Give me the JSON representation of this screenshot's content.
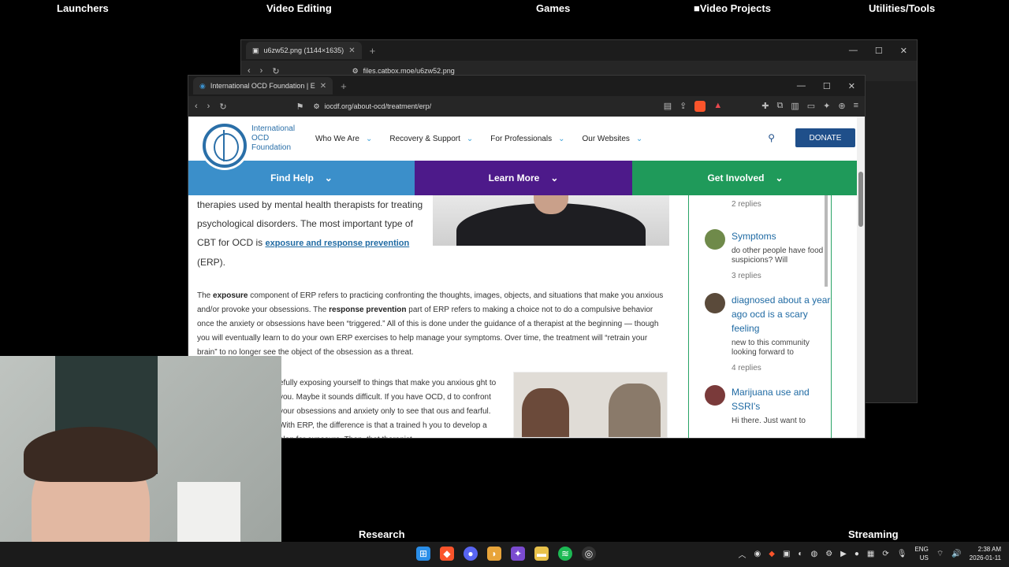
{
  "desktop": {
    "labels": [
      "Launchers",
      "Video Editing",
      "Games",
      "Video Projects",
      "Utilities/Tools",
      "Research",
      "Streaming"
    ]
  },
  "back_window": {
    "tab_title": "u6zw52.png (1144×1635)",
    "url": "files.catbox.moe/u6zw52.png"
  },
  "front_window": {
    "tab_title": "International OCD Foundation | E",
    "url": "iocdf.org/about-ocd/treatment/erp/"
  },
  "site": {
    "logo_line1": "International",
    "logo_line2": "OCD",
    "logo_line3": "Foundation",
    "nav": [
      "Who We Are",
      "Recovery & Support",
      "For Professionals",
      "Our Websites"
    ],
    "donate": "DONATE",
    "bands": [
      {
        "label": "Find Help",
        "color": "#3b8fca"
      },
      {
        "label": "Learn More",
        "color": "#4d1a8a"
      },
      {
        "label": "Get Involved",
        "color": "#1f9a5a"
      }
    ]
  },
  "article": {
    "intro_1": "therapies used by mental health therapists for treating psychological disorders. The most important type of CBT for OCD is ",
    "intro_link": "exposure and response prevention",
    "intro_2": " (ERP).",
    "p1_a": "The ",
    "p1_b": "exposure",
    "p1_c": " component of ERP refers to practicing confronting the thoughts, images, objects, and situations that make you anxious and/or provoke your obsessions. The ",
    "p1_d": "response prevention",
    "p1_e": " part of ERP refers to making a choice not to do a compulsive behavior once the anxiety or obsessions have been “triggered.” All of this is done under the guidance of a therapist at the beginning — though you will eventually learn to do your own ERP exercises to help manage your symptoms. Over time, the treatment will “retrain your brain” to no longer see the object of the obsession as a threat.",
    "p2": "efully exposing yourself to things that make you anxious ght to you. Maybe it sounds difficult. If you have OCD, d to confront your obsessions and anxiety only to see that ous and fearful. With ERP, the difference is that a trained h you to develop a plan for exposure. Then, that therapist"
  },
  "sidebar": {
    "top_replies": "2 replies",
    "items": [
      {
        "title": "Symptoms",
        "excerpt": "do other people have food suspicions? Will",
        "replies": "3 replies",
        "avatar_color": "#6f8a4a"
      },
      {
        "title": "diagnosed about a year ago ocd is a scary feeling",
        "excerpt": "new to this community looking forward to",
        "replies": "4 replies",
        "avatar_color": "#5a4a3a"
      },
      {
        "title": "Marijuana use and SSRI's",
        "excerpt": "Hi there. Just want to",
        "replies": "",
        "avatar_color": "#7a3a3a"
      }
    ]
  },
  "tray": {
    "lang": "ENG",
    "region": "US",
    "time": "2:38 AM",
    "date": "2026-01-11"
  }
}
